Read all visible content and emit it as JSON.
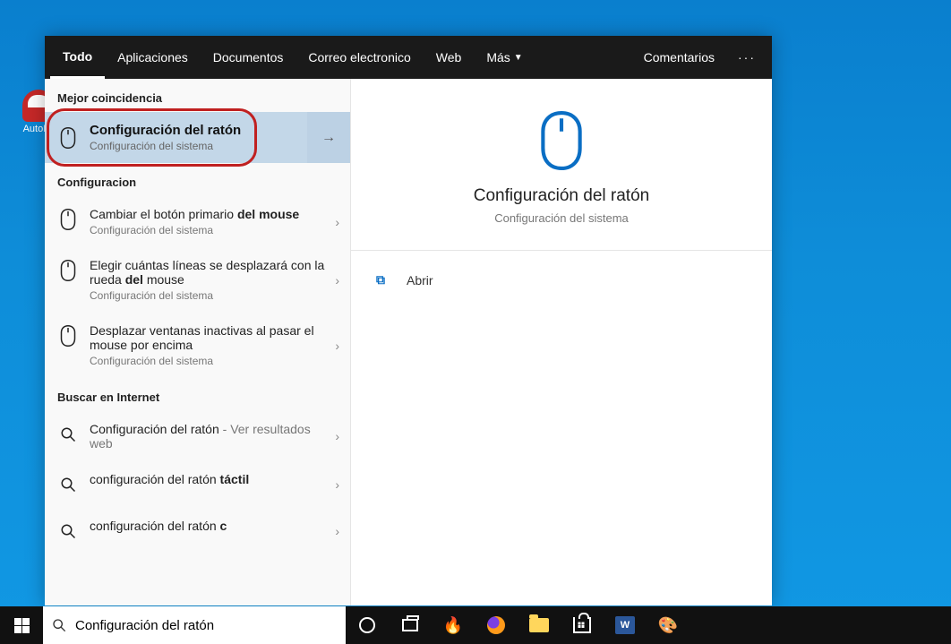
{
  "desktop": {
    "icon_label": "AutoI..."
  },
  "tabs": {
    "all": "Todo",
    "apps": "Aplicaciones",
    "docs": "Documentos",
    "email": "Correo electronico",
    "web": "Web",
    "more": "Más",
    "feedback": "Comentarios"
  },
  "left": {
    "best_match_header": "Mejor coincidencia",
    "best_match": {
      "title": "Configuración del ratón",
      "sub": "Configuración del sistema"
    },
    "config_header": "Configuracion",
    "items": [
      {
        "title_a": "Cambiar el botón primario ",
        "title_b": "del mouse",
        "sub": "Configuración del sistema"
      },
      {
        "title_a": "Elegir cuántas líneas se desplazará con la rueda ",
        "title_b": "del",
        "title_c": " mouse",
        "sub": "Configuración del sistema"
      },
      {
        "title_a": "Desplazar ventanas inactivas al pasar el mouse por encima",
        "sub": "Configuración del sistema"
      }
    ],
    "web_header": "Buscar en Internet",
    "web_items": [
      {
        "title_a": "Configuración del ratón",
        "title_b": " - Ver resultados web"
      },
      {
        "title_a": "configuración del ratón ",
        "title_b": "táctil"
      },
      {
        "title_a": "configuración del ratón ",
        "title_b": "c"
      }
    ]
  },
  "preview": {
    "title": "Configuración del ratón",
    "sub": "Configuración del sistema",
    "open": "Abrir"
  },
  "taskbar": {
    "search_value": "Configuración del ratón"
  }
}
